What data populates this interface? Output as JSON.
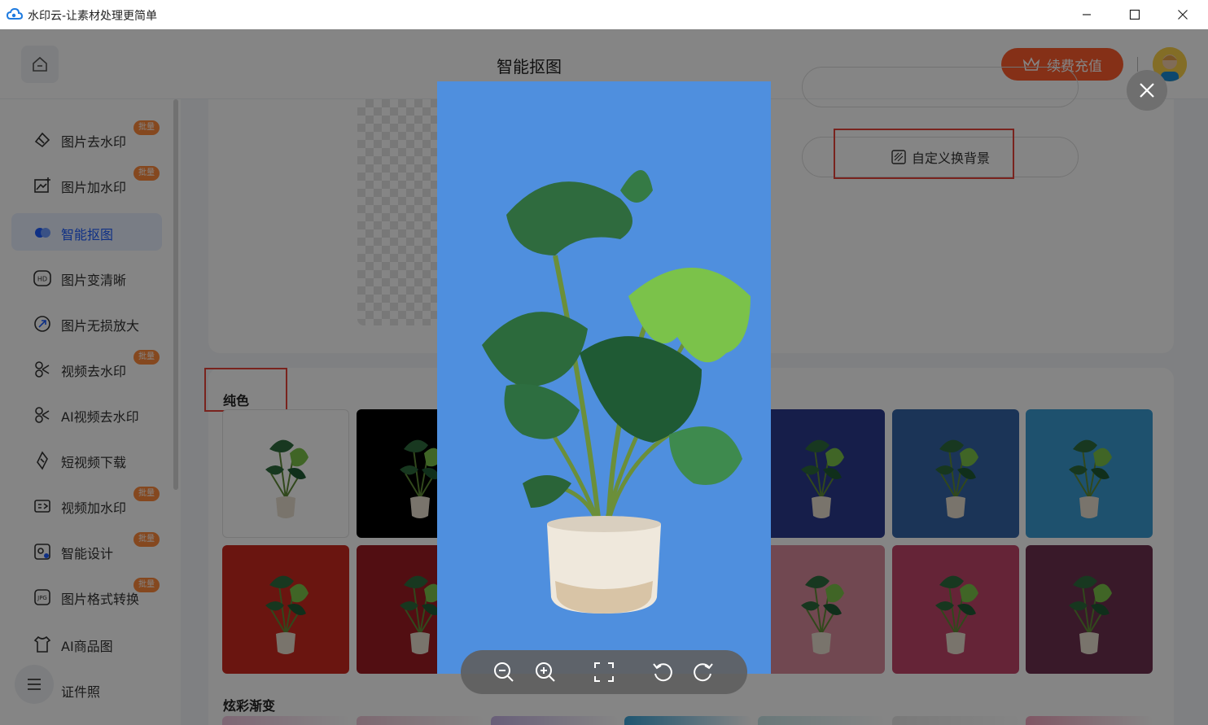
{
  "window": {
    "title": "水印云-让素材处理更简单"
  },
  "header": {
    "page_title": "智能抠图",
    "recharge_label": "续费充值"
  },
  "sidebar": {
    "items": [
      {
        "label": "图片去水印",
        "icon": "eraser-icon",
        "badge": "批量"
      },
      {
        "label": "图片加水印",
        "icon": "image-add-icon",
        "badge": "批量"
      },
      {
        "label": "智能抠图",
        "icon": "cutout-icon",
        "badge": "",
        "active": true
      },
      {
        "label": "图片变清晰",
        "icon": "hd-icon",
        "badge": ""
      },
      {
        "label": "图片无损放大",
        "icon": "enlarge-icon",
        "badge": ""
      },
      {
        "label": "视频去水印",
        "icon": "video-eraser-icon",
        "badge": "批量"
      },
      {
        "label": "AI视频去水印",
        "icon": "ai-video-icon",
        "badge": ""
      },
      {
        "label": "短视频下载",
        "icon": "download-icon",
        "badge": ""
      },
      {
        "label": "视频加水印",
        "icon": "video-add-icon",
        "badge": "批量"
      },
      {
        "label": "智能设计",
        "icon": "design-icon",
        "badge": "批量"
      },
      {
        "label": "图片格式转换",
        "icon": "jpg-icon",
        "badge": "批量"
      },
      {
        "label": "AI商品图",
        "icon": "product-icon",
        "badge": ""
      },
      {
        "label": "证件照",
        "icon": "id-photo-icon",
        "badge": ""
      }
    ]
  },
  "editor": {
    "custom_bg_label": "自定义换背景"
  },
  "palette": {
    "solid_title": "纯色",
    "gradient_title": "炫彩渐变",
    "solid_colors": [
      "#ffffff",
      "#000000",
      "#2b3a8f",
      "#3565a8",
      "#3a9bd4",
      "#cc2a1f",
      "#9e1b24",
      "#d98a9b",
      "#c2466a",
      "#6e3150"
    ],
    "gradient_colors": [
      "#f3c6e0",
      "#f0c8d8",
      "#c9b6e8",
      "#3ba4d8",
      "#c9e6e8",
      "#e8e8e8",
      "#f4a6c0"
    ]
  },
  "preview": {
    "background": "#4f8fde"
  },
  "toolbar": {
    "tools": [
      "zoom-out-icon",
      "zoom-in-icon",
      "fit-screen-icon",
      "rotate-left-icon",
      "rotate-right-icon"
    ]
  }
}
